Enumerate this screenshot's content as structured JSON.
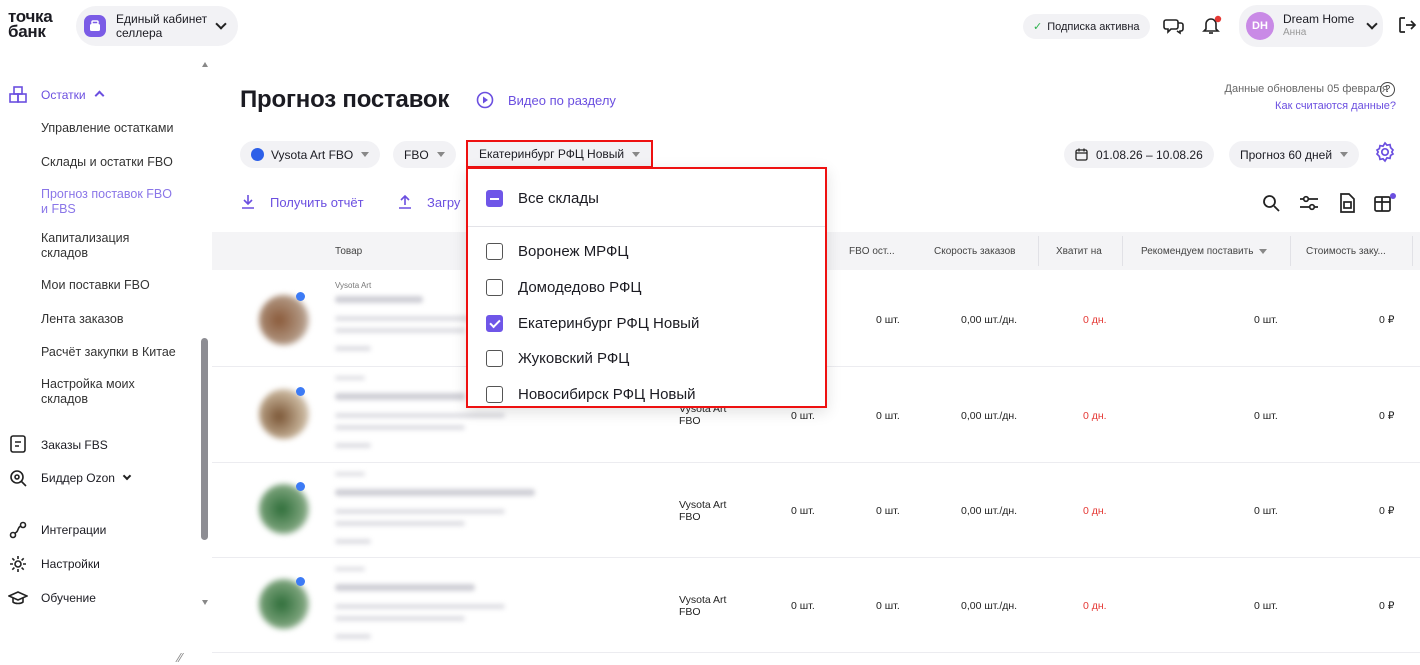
{
  "brand": {
    "line1": "точка",
    "line2": "банк"
  },
  "cabinet": {
    "line1": "Единый кабинет",
    "line2": "селлера"
  },
  "header": {
    "subscription": "Подписка активна",
    "user_name": "Dream Home",
    "user_sub": "Анна",
    "avatar": "DH"
  },
  "sidebar": {
    "section": "Остатки",
    "sub_items": [
      {
        "label": "Управление остатками"
      },
      {
        "label": "Склады и остатки FBO"
      },
      {
        "label": "Прогноз поставок FBO и FBS"
      },
      {
        "label": "Капитализация складов"
      },
      {
        "label": "Мои поставки FBO"
      },
      {
        "label": "Лента заказов"
      },
      {
        "label": "Расчёт закупки в Китае"
      },
      {
        "label": "Настройка моих складов"
      }
    ],
    "items": [
      {
        "label": "Заказы FBS"
      },
      {
        "label": "Биддер Ozon"
      },
      {
        "label": "Интеграции"
      },
      {
        "label": "Настройки"
      },
      {
        "label": "Обучение"
      }
    ]
  },
  "page": {
    "title": "Прогноз поставок",
    "video_link": "Видео по разделу",
    "updated": "Данные обновлены 05 февраля",
    "how_link": "Как считаются данные?",
    "filters": {
      "store": "Vysota Art FBO",
      "scheme": "FBO",
      "warehouse": "Екатеринбург РФЦ Новый",
      "dates": "01.08.26 – 10.08.26",
      "forecast": "Прогноз 60 дней"
    },
    "actions": {
      "report": "Получить отчёт",
      "upload": "Загру"
    }
  },
  "table": {
    "columns": [
      "Товар",
      "FBO ост...",
      "Скорость заказов",
      "Хватит на",
      "Рекомендуем поставить",
      "Стоимость заку..."
    ],
    "brand_label": "Vysota Art",
    "rows": [
      {
        "store": "",
        "fbs": "",
        "fbo": "0 шт.",
        "speed": "0,00 шт./дн.",
        "enough": "0 дн.",
        "recommend": "0 шт.",
        "cost": "0 ₽"
      },
      {
        "store": "Vysota Art FBO",
        "fbs": "0 шт.",
        "fbo": "0 шт.",
        "speed": "0,00 шт./дн.",
        "enough": "0 дн.",
        "recommend": "0 шт.",
        "cost": "0 ₽"
      },
      {
        "store": "Vysota Art FBO",
        "fbs": "0 шт.",
        "fbo": "0 шт.",
        "speed": "0,00 шт./дн.",
        "enough": "0 дн.",
        "recommend": "0 шт.",
        "cost": "0 ₽"
      },
      {
        "store": "Vysota Art FBO",
        "fbs": "0 шт.",
        "fbo": "0 шт.",
        "speed": "0,00 шт./дн.",
        "enough": "0 дн.",
        "recommend": "0 шт.",
        "cost": "0 ₽"
      }
    ]
  },
  "dropdown": {
    "all": "Все склады",
    "options": [
      {
        "label": "Воронеж МРФЦ",
        "checked": false
      },
      {
        "label": "Домодедово РФЦ",
        "checked": false
      },
      {
        "label": "Екатеринбург РФЦ Новый",
        "checked": true
      },
      {
        "label": "Жуковский РФЦ",
        "checked": false
      },
      {
        "label": "Новосибирск РФЦ Новый",
        "checked": false
      }
    ]
  },
  "colors": {
    "accent": "#6b4fe0",
    "highlight": "#e11111",
    "negative": "#e53935"
  }
}
